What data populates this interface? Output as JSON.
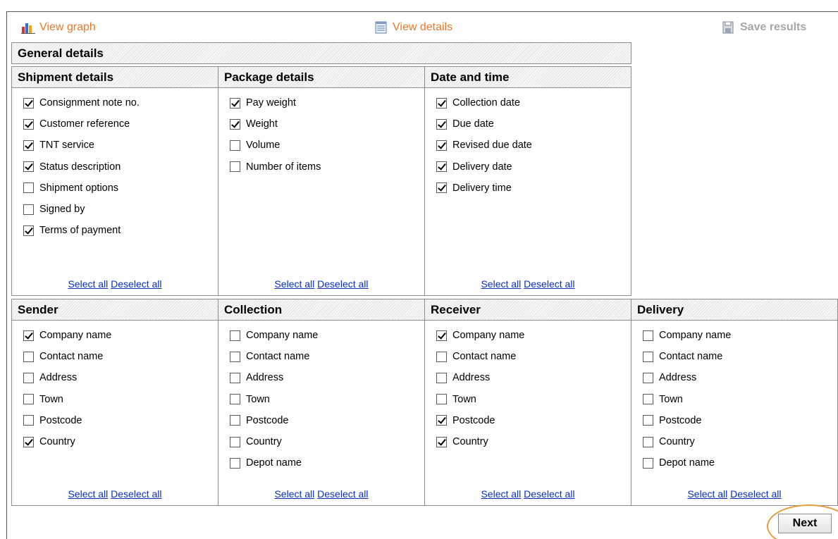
{
  "toolbar": {
    "view_graph": "View graph",
    "view_details": "View details",
    "save_results": "Save results"
  },
  "general_details": "General details",
  "panels": {
    "shipment": {
      "title": "Shipment details",
      "items": [
        {
          "label": "Consignment note no.",
          "checked": true
        },
        {
          "label": "Customer reference",
          "checked": true
        },
        {
          "label": "TNT service",
          "checked": true
        },
        {
          "label": "Status description",
          "checked": true
        },
        {
          "label": "Shipment options",
          "checked": false
        },
        {
          "label": "Signed by",
          "checked": false
        },
        {
          "label": "Terms of payment",
          "checked": true
        }
      ]
    },
    "package": {
      "title": "Package details",
      "items": [
        {
          "label": "Pay weight",
          "checked": true
        },
        {
          "label": "Weight",
          "checked": true
        },
        {
          "label": "Volume",
          "checked": false
        },
        {
          "label": "Number of items",
          "checked": false
        }
      ]
    },
    "datetime": {
      "title": "Date and time",
      "items": [
        {
          "label": "Collection date",
          "checked": true
        },
        {
          "label": "Due date",
          "checked": true
        },
        {
          "label": "Revised due date",
          "checked": true
        },
        {
          "label": "Delivery date",
          "checked": true
        },
        {
          "label": "Delivery time",
          "checked": true
        }
      ]
    },
    "sender": {
      "title": "Sender",
      "items": [
        {
          "label": "Company name",
          "checked": true
        },
        {
          "label": "Contact name",
          "checked": false
        },
        {
          "label": "Address",
          "checked": false
        },
        {
          "label": "Town",
          "checked": false
        },
        {
          "label": "Postcode",
          "checked": false
        },
        {
          "label": "Country",
          "checked": true
        }
      ]
    },
    "collection": {
      "title": "Collection",
      "items": [
        {
          "label": "Company name",
          "checked": false
        },
        {
          "label": "Contact name",
          "checked": false
        },
        {
          "label": "Address",
          "checked": false
        },
        {
          "label": "Town",
          "checked": false
        },
        {
          "label": "Postcode",
          "checked": false
        },
        {
          "label": "Country",
          "checked": false
        },
        {
          "label": "Depot name",
          "checked": false
        }
      ]
    },
    "receiver": {
      "title": "Receiver",
      "items": [
        {
          "label": "Company name",
          "checked": true
        },
        {
          "label": "Contact name",
          "checked": false
        },
        {
          "label": "Address",
          "checked": false
        },
        {
          "label": "Town",
          "checked": false
        },
        {
          "label": "Postcode",
          "checked": true
        },
        {
          "label": "Country",
          "checked": true
        }
      ]
    },
    "delivery": {
      "title": "Delivery",
      "items": [
        {
          "label": "Company name",
          "checked": false
        },
        {
          "label": "Contact name",
          "checked": false
        },
        {
          "label": "Address",
          "checked": false
        },
        {
          "label": "Town",
          "checked": false
        },
        {
          "label": "Postcode",
          "checked": false
        },
        {
          "label": "Country",
          "checked": false
        },
        {
          "label": "Depot name",
          "checked": false
        }
      ]
    }
  },
  "select_all": "Select all",
  "deselect_all": "Deselect all",
  "next_label": "Next",
  "colors": {
    "link_orange": "#e8792b",
    "link_blue": "#0a2fbf",
    "disabled_gray": "#a6a6a6",
    "highlight_ring": "#e89a3a"
  }
}
